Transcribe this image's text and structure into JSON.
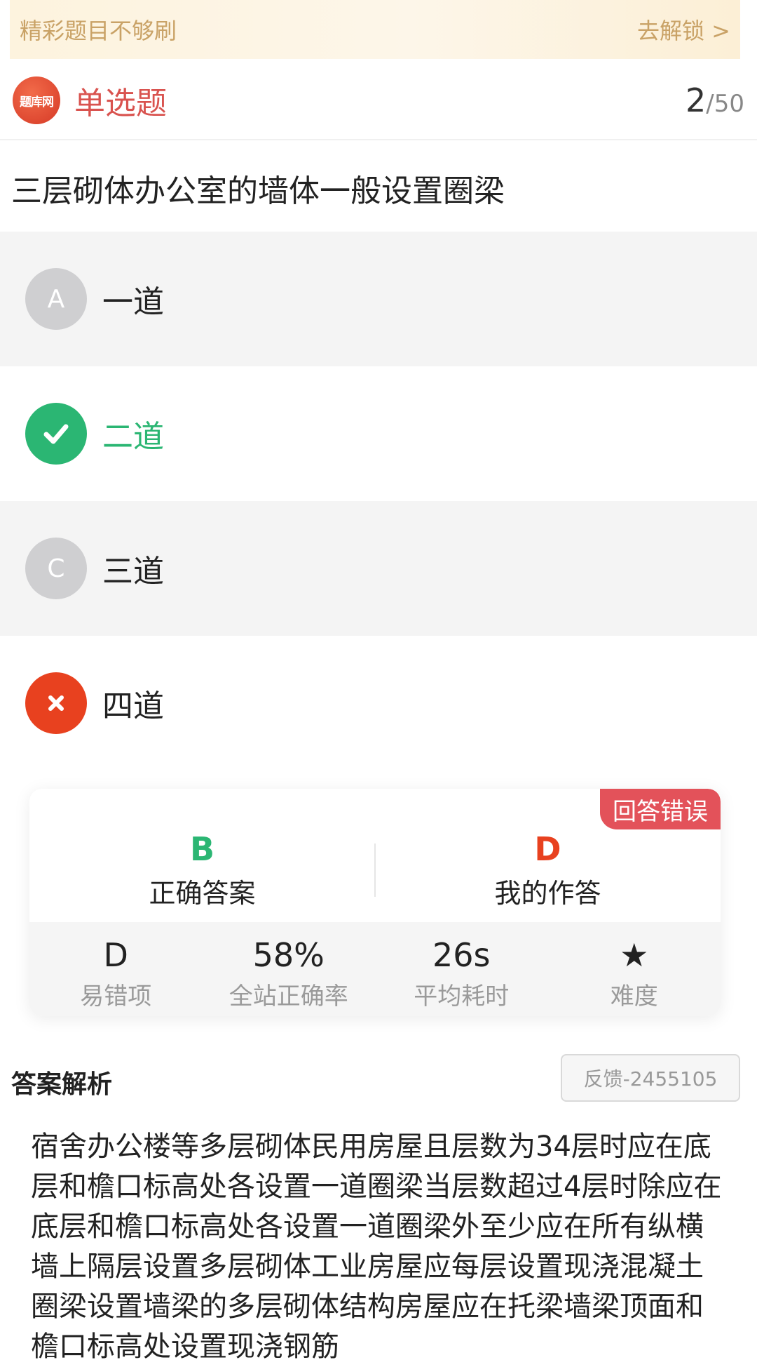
{
  "banner": {
    "text": "精彩题目不够刷",
    "link": "去解锁 >"
  },
  "header": {
    "logo_text": "题库网",
    "type": "单选题",
    "current": "2",
    "total": "/50"
  },
  "question": "三层砌体办公室的墙体一般设置圈梁",
  "options": [
    {
      "letter": "A",
      "text": "一道",
      "state": "none"
    },
    {
      "letter": "✓",
      "text": "二道",
      "state": "correct"
    },
    {
      "letter": "C",
      "text": "三道",
      "state": "none"
    },
    {
      "letter": "✕",
      "text": "四道",
      "state": "wrong"
    }
  ],
  "result": {
    "badge": "回答错误",
    "correct_letter": "B",
    "correct_label": "正确答案",
    "my_letter": "D",
    "my_label": "我的作答",
    "colors": {
      "correct": "#2bb673",
      "wrong": "#e8411f"
    }
  },
  "stats": [
    {
      "value": "D",
      "label": "易错项"
    },
    {
      "value": "58%",
      "label": "全站正确率"
    },
    {
      "value": "26s",
      "label": "平均耗时"
    },
    {
      "value": "★",
      "label": "难度",
      "icon": "star-icon"
    }
  ],
  "analysis": {
    "title": "答案解析",
    "feedback": "反馈-2455105",
    "text": "宿舍办公楼等多层砌体民用房屋且层数为34层时应在底层和檐口标高处各设置一道圈梁当层数超过4层时除应在底层和檐口标高处各设置一道圈梁外至少应在所有纵横墙上隔层设置多层砌体工业房屋应每层设置现浇混凝土圈梁设置墙梁的多层砌体结构房屋应在托梁墙梁顶面和檐口标高处设置现浇钢筋"
  }
}
